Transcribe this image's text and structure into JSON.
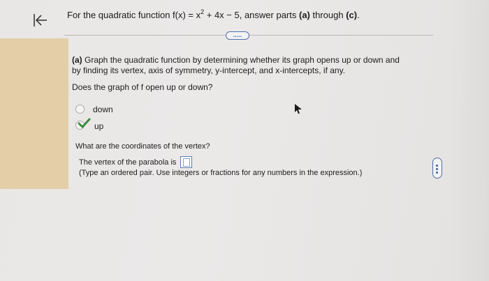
{
  "header": {
    "prefix": "For the quadratic function f(x) = x",
    "exponent": "2",
    "suffix": " + 4x − 5, answer parts ",
    "part_a": "(a)",
    "through": " through ",
    "part_c": "(c)",
    "period": "."
  },
  "more_button": {
    "label": "....."
  },
  "part_a": {
    "label": "(a)",
    "text": " Graph the quadratic function by determining whether its graph opens up or down and by finding its vertex, axis of symmetry, y-intercept, and x-intercepts, if any."
  },
  "question_open": "Does the graph of f open up or down?",
  "options": [
    {
      "label": "down",
      "selected": false
    },
    {
      "label": "up",
      "selected": true
    }
  ],
  "question_vertex": "What are the coordinates of the vertex?",
  "answer": {
    "prompt": "The vertex of the parabola is",
    "hint": "(Type an ordered pair. Use integers or fractions for any numbers in the expression.)"
  },
  "icons": {
    "back": "first-page-icon",
    "check": "check-icon",
    "cursor": "mouse-pointer-icon"
  },
  "colors": {
    "accent": "#4f6fa8",
    "highlight_band": "#e3cea8",
    "check_green": "#3a8a3e"
  }
}
